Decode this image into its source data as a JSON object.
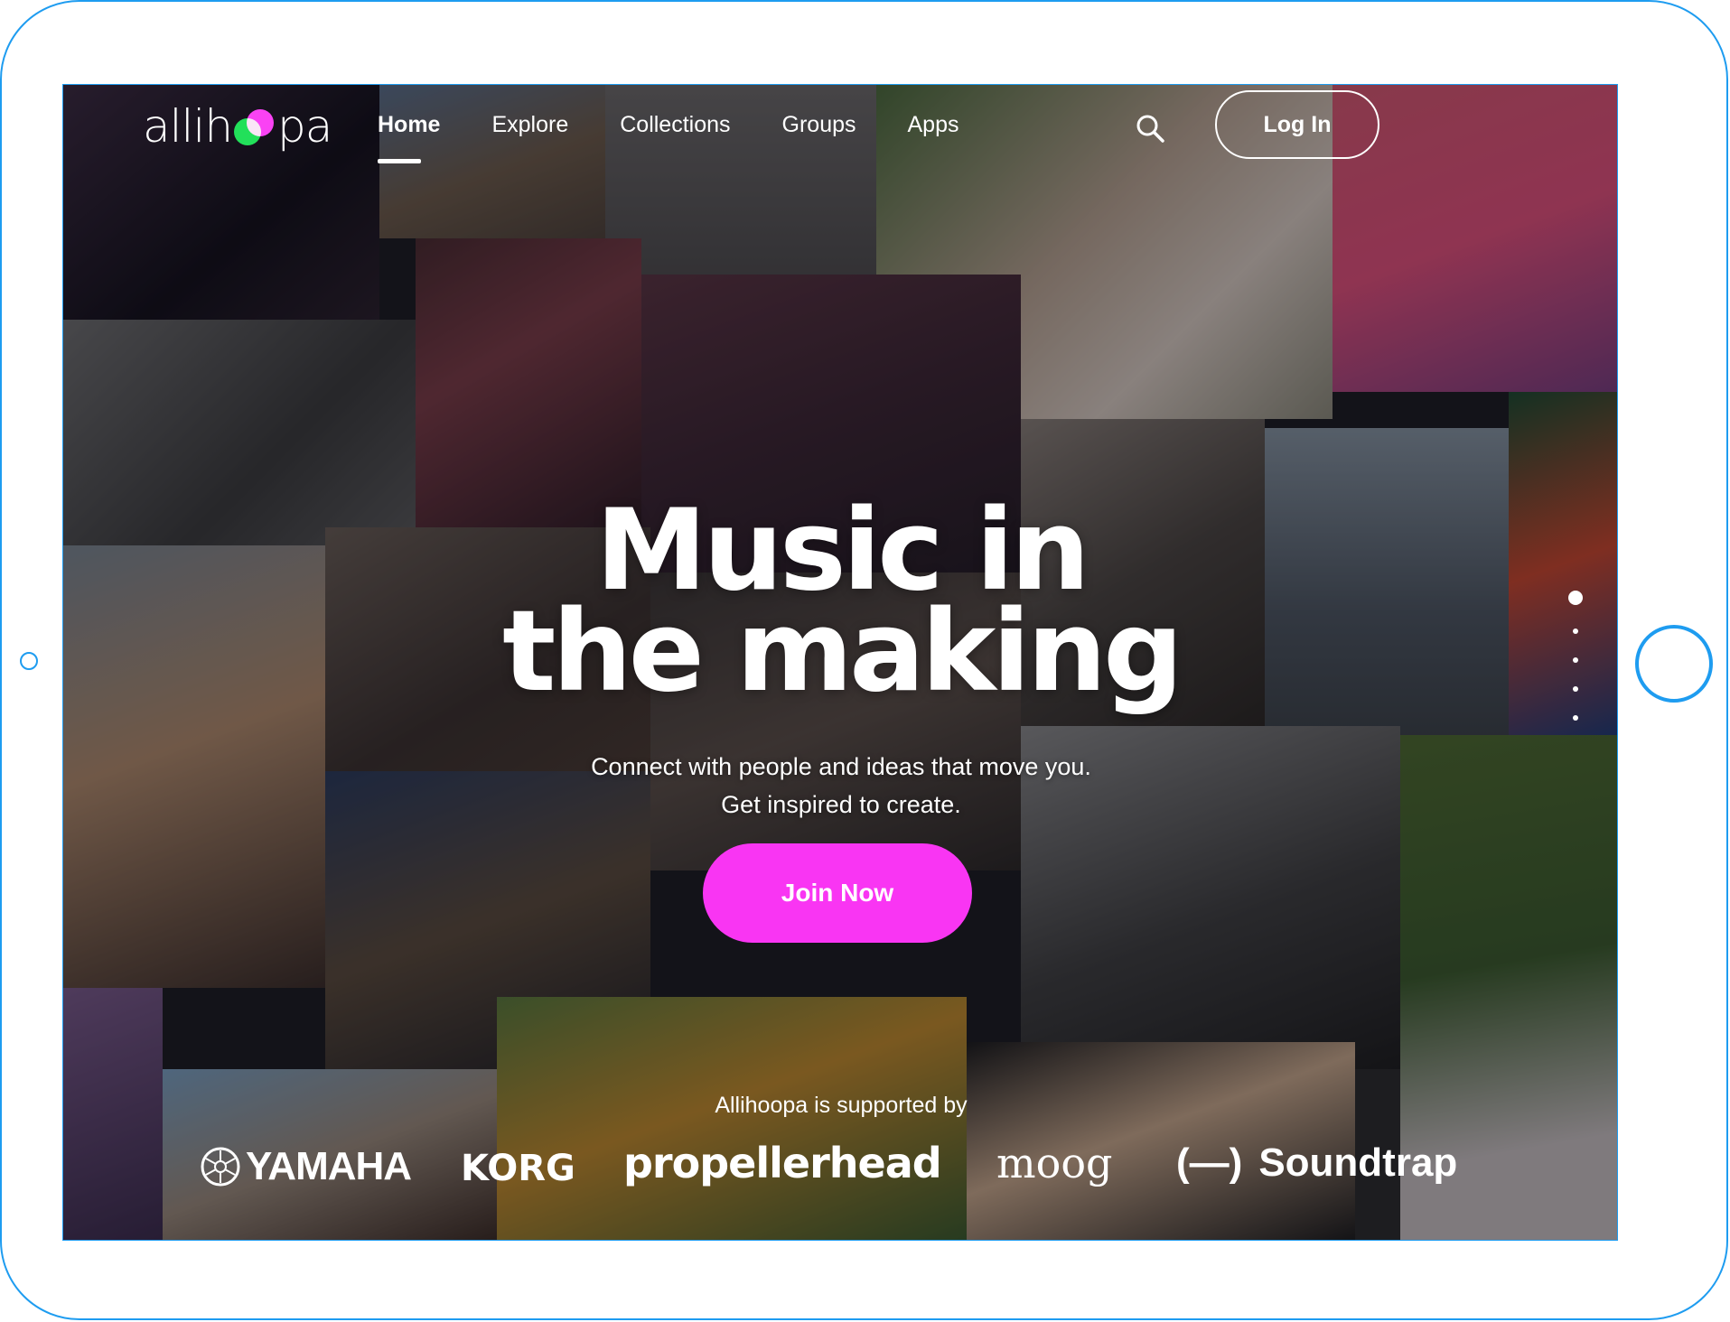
{
  "brand": {
    "logo_left": "allih",
    "logo_right": "pa",
    "colors": {
      "accent_pink": "#f935f3",
      "logo_green": "#22e05a",
      "frame_blue": "#1e9cf0"
    }
  },
  "nav": {
    "items": [
      {
        "label": "Home",
        "active": true
      },
      {
        "label": "Explore"
      },
      {
        "label": "Collections"
      },
      {
        "label": "Groups"
      },
      {
        "label": "Apps"
      }
    ],
    "search_icon": "search-icon",
    "login_label": "Log In"
  },
  "hero": {
    "title_line1": "Music in",
    "title_line2": "the making",
    "subtitle_line1": "Connect with people and ideas that move you.",
    "subtitle_line2": "Get inspired to create.",
    "cta_label": "Join Now"
  },
  "carousel": {
    "slides": 5,
    "active": 0
  },
  "supporters": {
    "caption": "Allihoopa is supported by",
    "logos": [
      "YAMAHA",
      "KORG",
      "propellerhead",
      "moog",
      "Soundtrap"
    ],
    "soundtrap_mark": "(—)"
  }
}
